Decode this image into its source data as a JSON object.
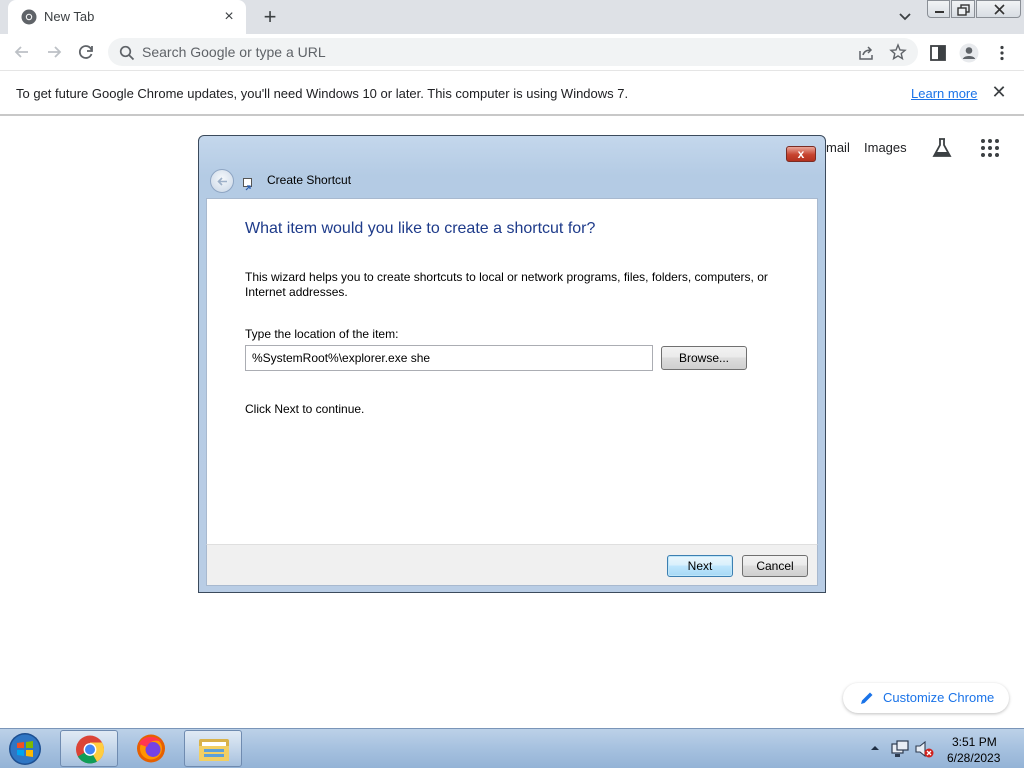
{
  "browser": {
    "tab_title": "New Tab",
    "omnibox_placeholder": "Search Google or type a URL"
  },
  "infobar": {
    "message": "To get future Google Chrome updates, you'll need Windows 10 or later. This computer is using Windows 7.",
    "link": "Learn more"
  },
  "ntp": {
    "gmail": "mail",
    "images": "Images",
    "customize": "Customize Chrome"
  },
  "dialog": {
    "title": "Create Shortcut",
    "heading": "What item would you like to create a shortcut for?",
    "description": "This wizard helps you to create shortcuts to local or network programs, files, folders, computers, or Internet addresses.",
    "location_label": "Type the location of the item:",
    "location_value": "%SystemRoot%\\explorer.exe she",
    "browse_label": "Browse...",
    "continue_text": "Click Next to continue.",
    "next_label": "Next",
    "cancel_label": "Cancel",
    "close_glyph": "x"
  },
  "taskbar": {
    "time": "3:51 PM",
    "date": "6/28/2023"
  },
  "icons": {
    "tab_close": "×",
    "new_tab": "+",
    "infobar_close": "✕"
  },
  "colors": {
    "link_blue": "#1a73e8",
    "dialog_heading": "#1e3b8a",
    "taskbar": "#a6c1df"
  }
}
